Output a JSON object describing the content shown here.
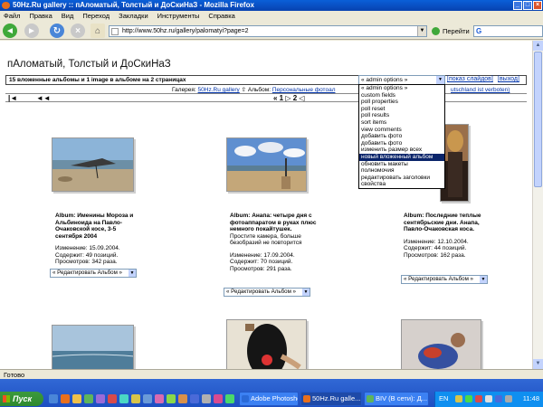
{
  "window": {
    "title": "50Hz.Ru gallery :: пАломатый, Толстый и ДоСкиНаЗ - Mozilla Firefox"
  },
  "menu": [
    "Файл",
    "Правка",
    "Вид",
    "Переход",
    "Закладки",
    "Инструменты",
    "Справка"
  ],
  "nav": {
    "url": "http://www.50hz.ru/gallery/palomatyi?page=2",
    "go_label": "Перейти",
    "search_glyph": "G"
  },
  "page": {
    "title": "пАломатый, Толстый и ДоСкиНаЗ",
    "info": "15 вложенные альбомы и 1 image в альбоме на 2 страницах",
    "admin_select": "« admin options »",
    "slideshow_link": "[показ слайдов]",
    "logout_link": "[выход]",
    "breadcrumb": {
      "gallery_label": "Галерея:",
      "gallery_link": "50Hz.Ru gallery",
      "album_label": "Альбом:",
      "album_link": "Персональные фотоал",
      "tail_link": "utschland ist verboten)"
    },
    "pager": {
      "first": "|◄",
      "prev": "◄◄",
      "page_label": "« 1 ▷ 2 ◁",
      "next": "►►",
      "last": "►|"
    }
  },
  "admin_options": [
    "« admin options »",
    "custom fields",
    "poll properties",
    "poll reset",
    "poll results",
    "sort items",
    "view comments",
    "добавить фото",
    "добавить фото",
    "изменить размер всех",
    "новый вложенный альбом",
    "обновить макеты",
    "полномочия",
    "редактировать заголовки",
    "свойства"
  ],
  "admin_selected_index": 10,
  "albums": [
    {
      "title": "Album: Именины Мороза и Альбиноида на Павло-Очаковской косе, 3-5 сентября 2004",
      "desc": "",
      "changed": "Изменение: 15.09.2004.",
      "contains": "Содержит: 49 позиций.",
      "views": "Просмотров: 342 раза.",
      "edit": "« Редактировать Альбом »"
    },
    {
      "title": "Album: Анапа: четыре дня с фотоаппаратом в руках плюс немного покайтушек.",
      "desc": "Простите камера, больше безобразий не повторится",
      "changed": "Изменение: 17.09.2004.",
      "contains": "Содержит: 70 позиций.",
      "views": "Просмотров: 291 раза.",
      "edit": "« Редактировать Альбом »"
    },
    {
      "title": "Album: Последние теплые сентябрьские дни. Анапа, Павло-Очаковская коса.",
      "desc": "",
      "changed": "Изменение: 12.10.2004.",
      "contains": "Содержит: 44 позиций.",
      "views": "Просмотров: 162 раза.",
      "edit": "« Редактировать Альбом »"
    }
  ],
  "status": "Готово",
  "taskbar": {
    "start": "Пуск",
    "items": [
      "Adobe Photoshop",
      "50Hz.Ru galle...",
      "BIV (В сети): Д..."
    ],
    "tray_lang": "EN",
    "clock": "11:48"
  }
}
